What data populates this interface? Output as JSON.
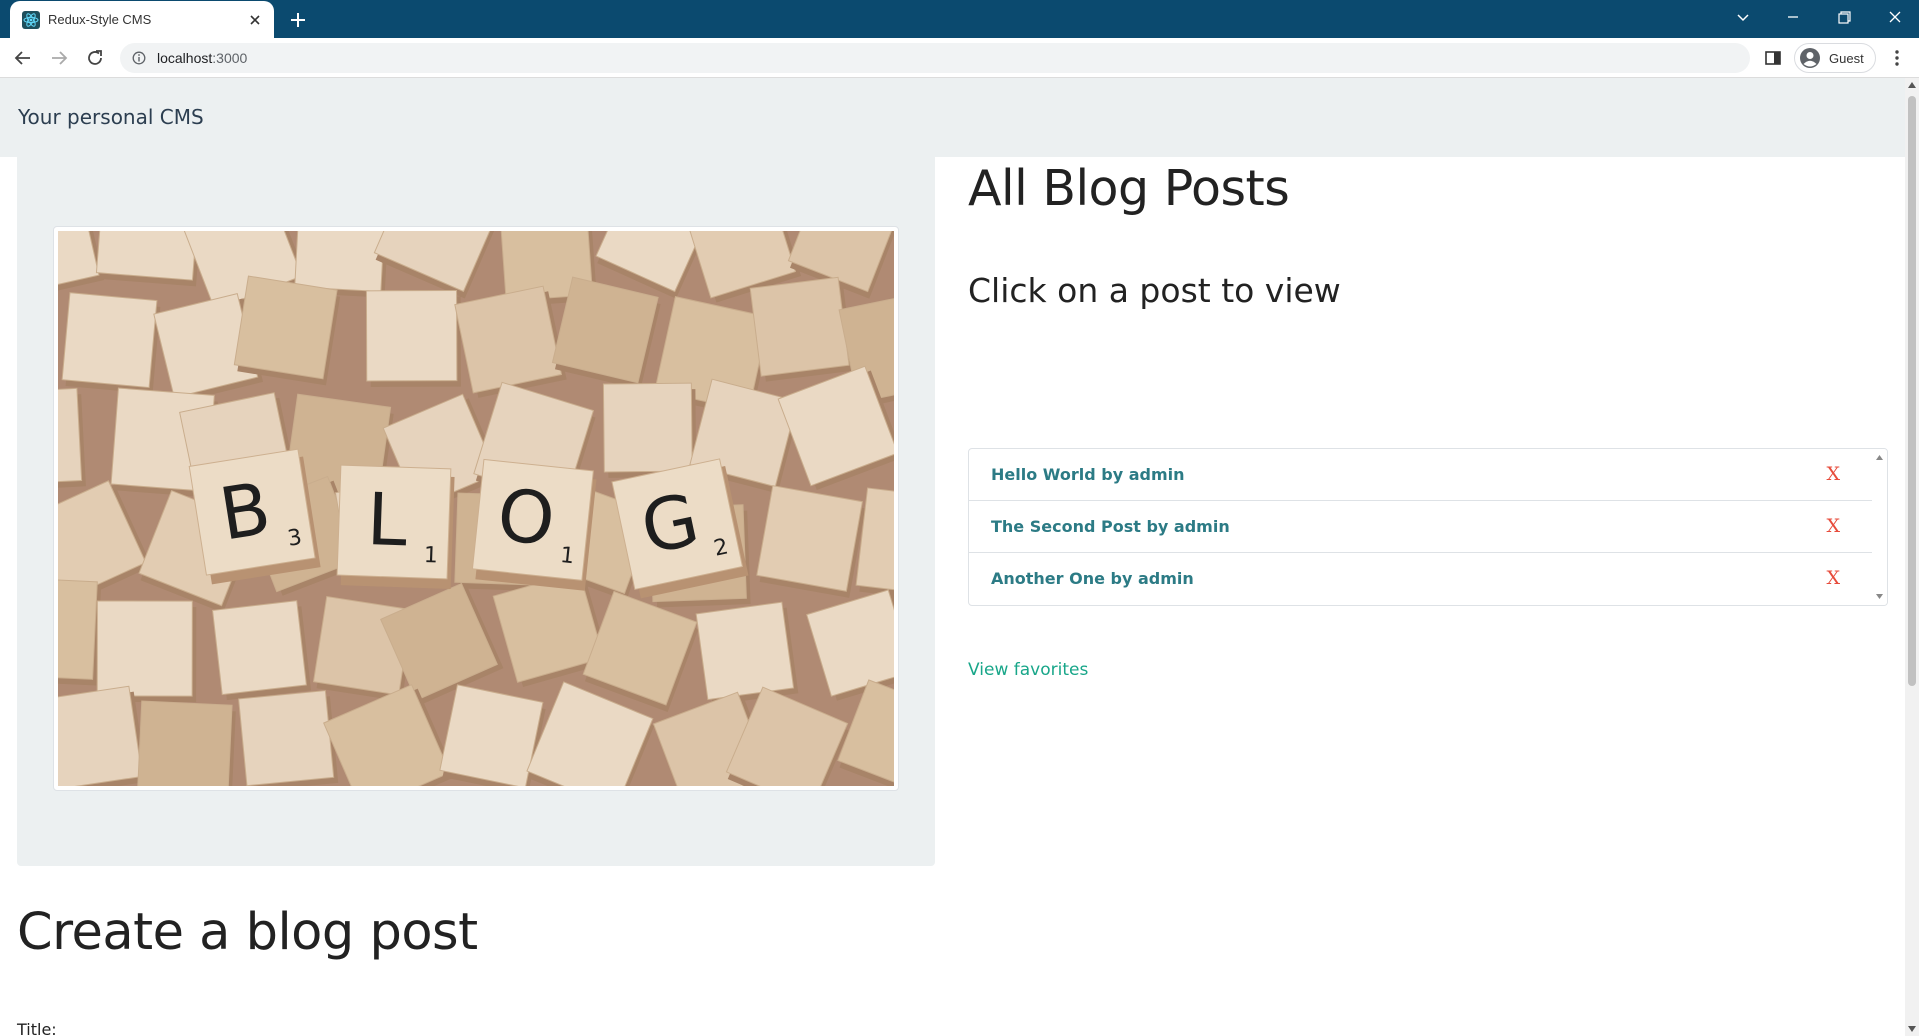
{
  "browser": {
    "tab_title": "Redux-Style CMS",
    "url_host": "localhost",
    "url_port": ":3000",
    "profile_label": "Guest"
  },
  "page": {
    "brand": "Your personal CMS",
    "all_posts_title": "All Blog Posts",
    "subtitle": "Click on a post to view",
    "posts": [
      {
        "label": "Hello World by admin",
        "delete": "X"
      },
      {
        "label": "The Second Post by admin",
        "delete": "X"
      },
      {
        "label": "Another One by admin",
        "delete": "X"
      }
    ],
    "view_favorites": "View favorites",
    "create_title": "Create a blog post",
    "title_label": "Title:"
  },
  "hero_image": {
    "tiles": [
      "B",
      "L",
      "O",
      "G"
    ],
    "tile_scores": [
      "3",
      "1",
      "1",
      "2"
    ]
  },
  "colors": {
    "chrome_bar": "#0b4a6f",
    "panel_bg": "#ecf0f1",
    "link_teal": "#2c7b85",
    "favorites_green": "#18a689",
    "delete_red": "#e74c3c"
  }
}
